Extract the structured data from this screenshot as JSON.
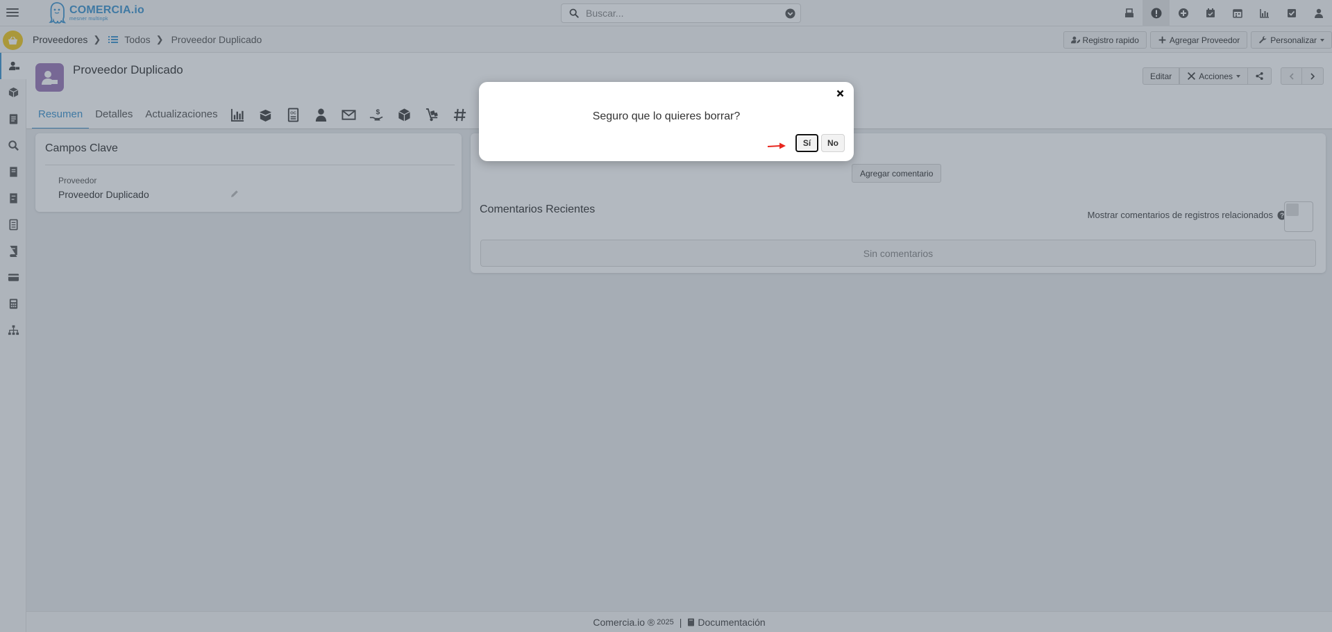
{
  "app": {
    "logo_name": "COMERCIA.io",
    "logo_tagline": "mesner multinpk"
  },
  "search": {
    "placeholder": "Buscar..."
  },
  "top_icons": [
    "inbox-icon",
    "alert-icon",
    "plus-circle-icon",
    "calendar-check-icon",
    "calendar-icon",
    "bar-chart-icon",
    "checkbox-icon",
    "user-icon"
  ],
  "breadcrumb": {
    "module": "Proveedores",
    "list": "Todos",
    "current": "Proveedor Duplicado"
  },
  "toolbar": {
    "quick_register": "Registro rapido",
    "add_supplier": "Agregar Proveedor",
    "customize": "Personalizar"
  },
  "record": {
    "title": "Proveedor Duplicado",
    "edit_label": "Editar",
    "actions_label": "Acciones"
  },
  "tabs": {
    "summary": "Resumen",
    "details": "Detalles",
    "updates": "Actualizaciones"
  },
  "key_fields": {
    "title": "Campos Clave",
    "supplier_label": "Proveedor",
    "supplier_value": "Proveedor Duplicado"
  },
  "comments": {
    "add_label": "Agregar comentario",
    "title": "Comentarios Recientes",
    "related_label": "Mostrar comentarios de registros relacionados",
    "empty_label": "Sin comentarios"
  },
  "footer": {
    "brand": "Comercia.io",
    "copyright": "®",
    "year": "2025",
    "separator": "|",
    "docs": "Documentación"
  },
  "modal": {
    "message": "Seguro que lo quieres borrar?",
    "yes_label": "Sí",
    "no_label": "No"
  },
  "colors": {
    "accent": "#3f94cf",
    "module_badge": "#f0c820",
    "avatar": "#9b78b8",
    "arrow_hint": "#e8261e"
  }
}
